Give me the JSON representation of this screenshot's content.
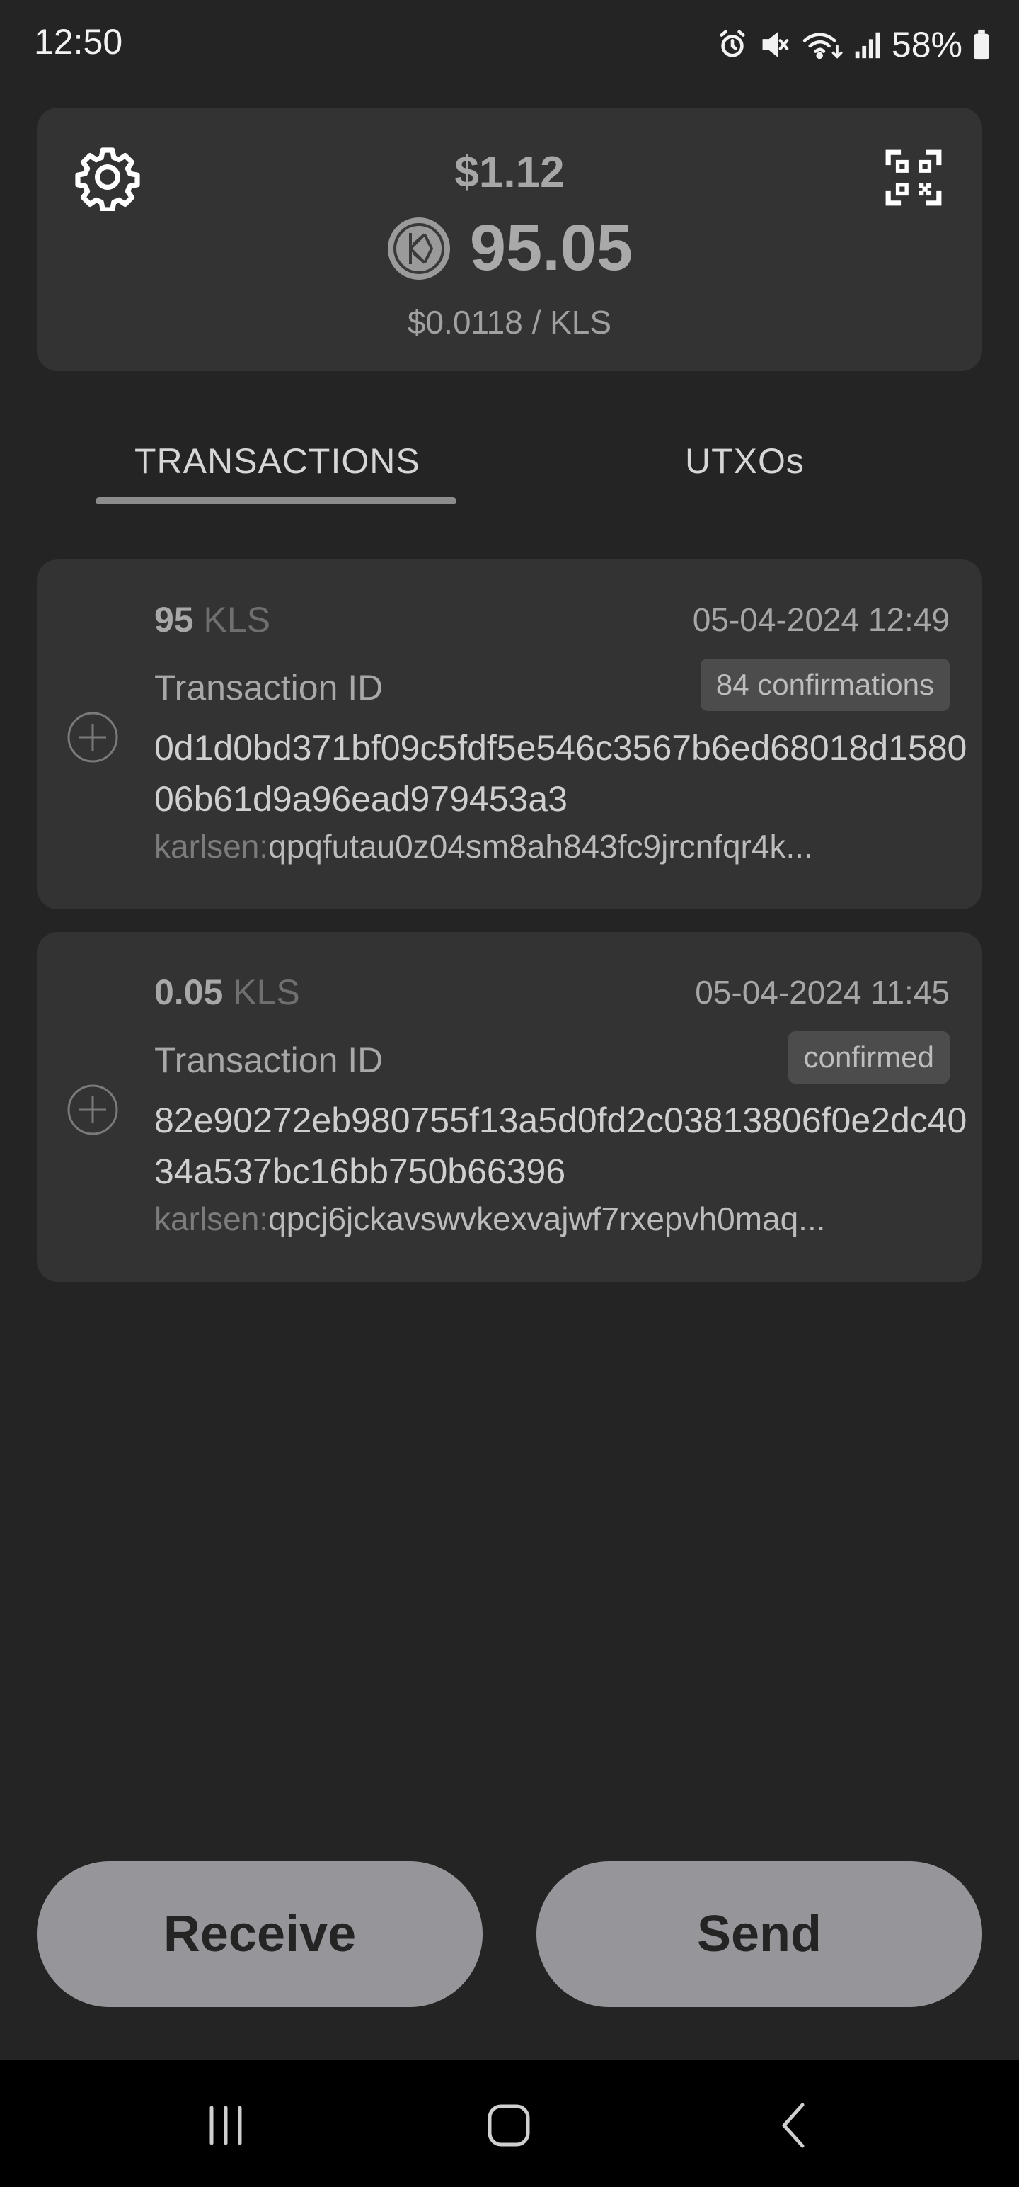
{
  "status_bar": {
    "time": "12:50",
    "battery": "58%",
    "icons": [
      "alarm-icon",
      "mute-icon",
      "wifi-icon",
      "signal-icon",
      "battery-icon"
    ]
  },
  "balance": {
    "fiat": "$1.12",
    "kls": "95.05",
    "price": "$0.0118 / KLS",
    "icons": [
      "gear-icon",
      "qr-code-icon",
      "karlsen-logo-icon"
    ]
  },
  "tabs": [
    {
      "label": "TRANSACTIONS",
      "active": true
    },
    {
      "label": "UTXOs",
      "active": false
    }
  ],
  "transactions": [
    {
      "amount": "95",
      "unit": "KLS",
      "date": "05-04-2024 12:49",
      "label": "Transaction ID",
      "status": "84 confirmations",
      "hash": "0d1d0bd371bf09c5fdf5e546c3567b6ed68018d158006b61d9a96ead979453a3",
      "address_prefix": "karlsen:",
      "address": "qpqfutau0z04sm8ah843fc9jrcnfqr4k..."
    },
    {
      "amount": "0.05",
      "unit": "KLS",
      "date": "05-04-2024 11:45",
      "label": "Transaction ID",
      "status": "confirmed",
      "hash": "82e90272eb980755f13a5d0fd2c03813806f0e2dc4034a537bc16bb750b66396",
      "address_prefix": "karlsen:",
      "address": "qpcj6jckavswvkexvajwf7rxepvh0maq..."
    }
  ],
  "actions": {
    "receive": "Receive",
    "send": "Send"
  },
  "nav": {
    "icons": [
      "recents-icon",
      "home-icon",
      "back-icon"
    ]
  },
  "colors": {
    "background": "#242424",
    "card": "#333333",
    "button": "#96969a",
    "nav_bar": "#000000"
  }
}
